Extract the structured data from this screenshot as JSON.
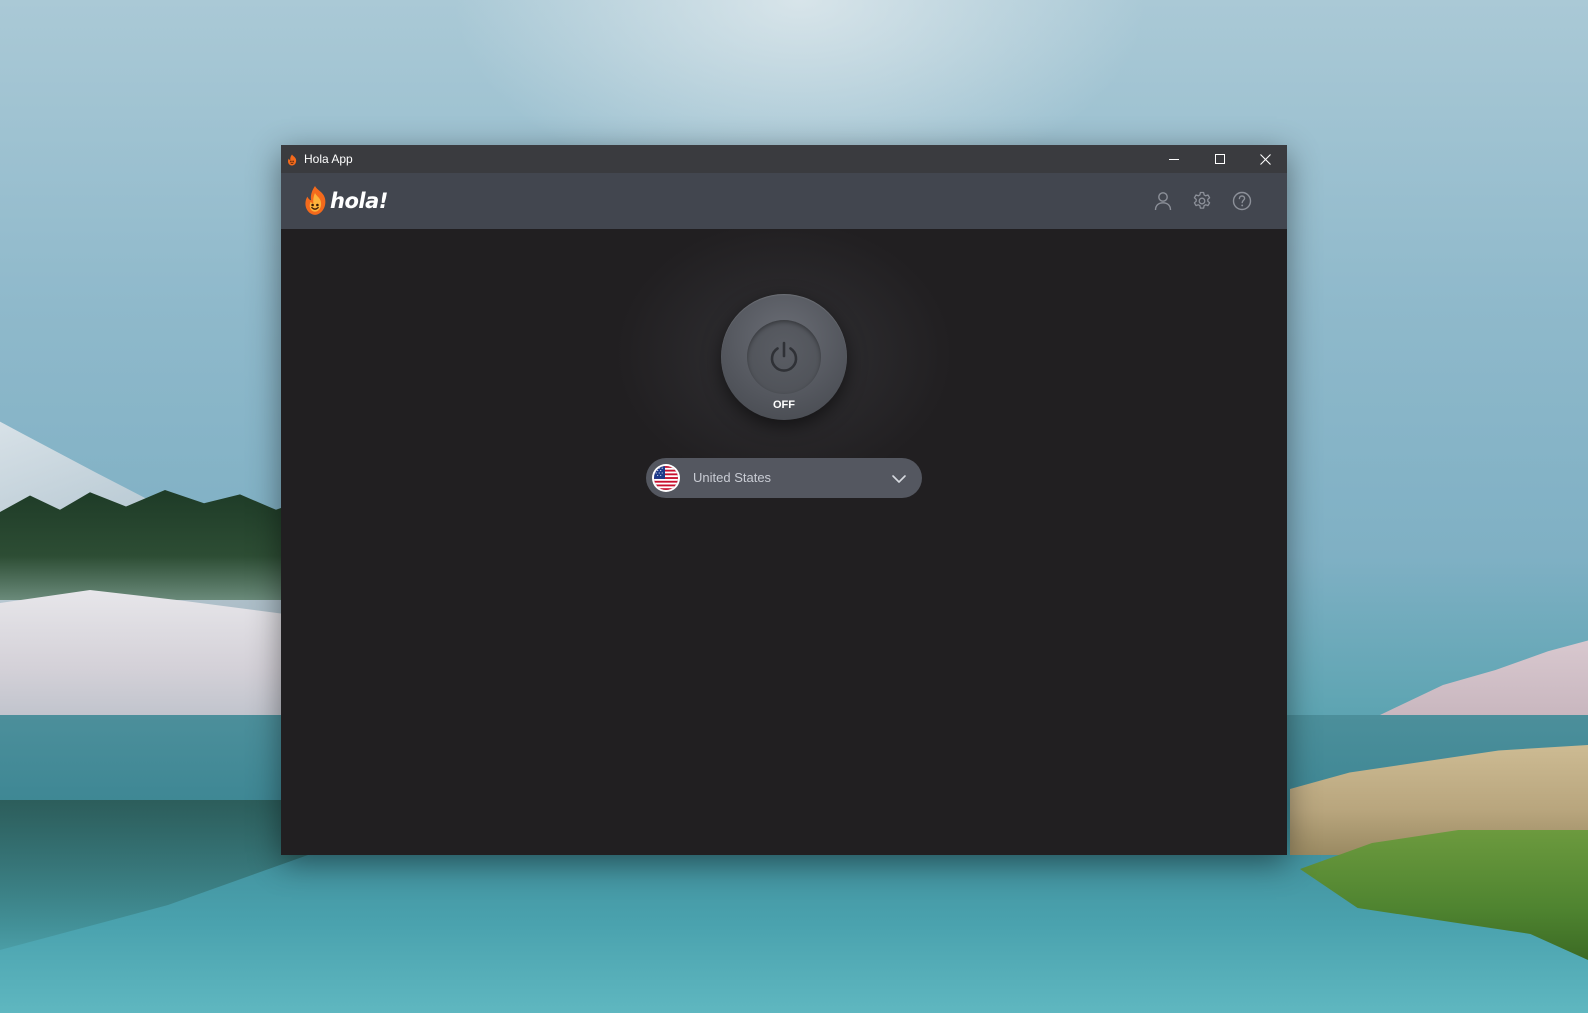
{
  "window": {
    "title": "Hola App"
  },
  "header": {
    "logo_text": "hola!",
    "icons": [
      "user-icon",
      "gear-icon",
      "help-icon"
    ]
  },
  "main": {
    "power": {
      "state_label": "OFF",
      "icon": "power-icon"
    },
    "country_selector": {
      "selected": "United States",
      "flag": "us-flag-icon"
    }
  },
  "colors": {
    "titlebar": "#3a3b3f",
    "header": "#42464f",
    "background": "#211f21",
    "power_button": "#53565d",
    "selector": "#545760",
    "logo_flame": "#f46a1c"
  }
}
